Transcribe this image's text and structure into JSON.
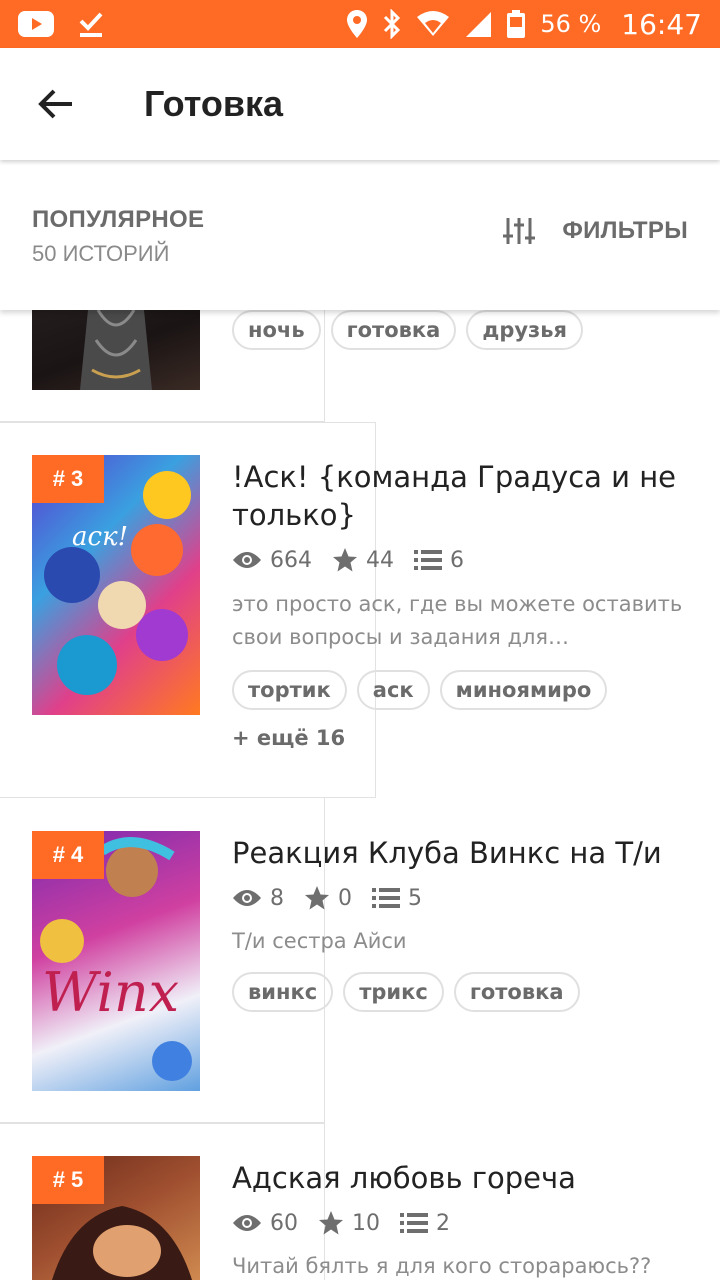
{
  "status_bar": {
    "battery": "56 %",
    "time": "16:47",
    "icons": [
      "youtube-icon",
      "download-done-icon",
      "location-icon",
      "bluetooth-icon",
      "wifi-icon",
      "signal-icon",
      "battery-icon"
    ]
  },
  "app_bar": {
    "title": "Готовка",
    "back_icon": "arrow-back-icon"
  },
  "sort_header": {
    "label": "ПОПУЛЯРНОЕ",
    "count": "50 ИСТОРИЙ",
    "filters_label": "ФИЛЬТРЫ",
    "filters_icon": "sliders-icon"
  },
  "colors": {
    "accent": "#ff6a24",
    "text_primary": "#222222",
    "text_secondary": "#8c8c8c"
  },
  "stories": [
    {
      "rank": "",
      "title": "",
      "tags": [
        "ночь",
        "готовка",
        "друзья"
      ]
    },
    {
      "rank": "# 3",
      "title": "!Аск! {команда Градуса и не только}",
      "views": "664",
      "votes": "44",
      "parts": "6",
      "description": "это просто аск, где вы можете оставить свои вопросы и задания для…",
      "tags": [
        "тортик",
        "аск",
        "миноямиро"
      ],
      "more": "+ ещё 16"
    },
    {
      "rank": "# 4",
      "title": "Реакция Клуба Винкс на Т/и",
      "views": "8",
      "votes": "0",
      "parts": "5",
      "description": "Т/и сестра Айси",
      "tags": [
        "винкс",
        "трикс",
        "готовка"
      ]
    },
    {
      "rank": "# 5",
      "title": "Адская любовь гореча",
      "views": "60",
      "votes": "10",
      "parts": "2",
      "description": "Читай бялть я для кого сторараюсь??"
    }
  ]
}
